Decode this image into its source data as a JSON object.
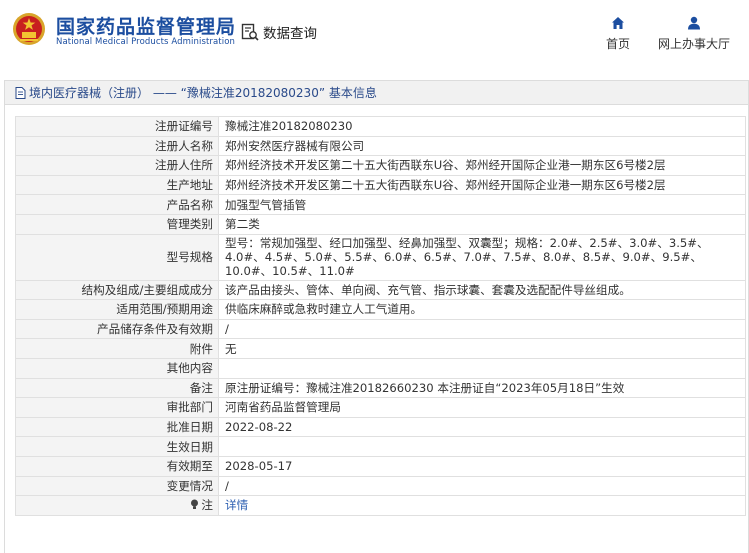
{
  "header": {
    "logo_cn": "国家药品监督管理局",
    "logo_en": "National Medical Products Administration",
    "query_label": "数据查询",
    "nav_home": "首页",
    "nav_office": "网上办事大厅",
    "brand_color": "#1c4ea0"
  },
  "panel": {
    "title": "境内医疗器械（注册） ——  “豫械注准20182080230”  基本信息"
  },
  "rows": [
    {
      "key": "注册证编号",
      "value": "豫械注准20182080230"
    },
    {
      "key": "注册人名称",
      "value": "郑州安然医疗器械有限公司"
    },
    {
      "key": "注册人住所",
      "value": "郑州经济技术开发区第二十五大街西联东U谷、郑州经开国际企业港一期东区6号楼2层"
    },
    {
      "key": "生产地址",
      "value": "郑州经济技术开发区第二十五大街西联东U谷、郑州经开国际企业港一期东区6号楼2层"
    },
    {
      "key": "产品名称",
      "value": "加强型气管插管"
    },
    {
      "key": "管理类别",
      "value": "第二类"
    },
    {
      "key": "型号规格",
      "value": "型号：常规加强型、经口加强型、经鼻加强型、双囊型；规格：2.0#、2.5#、3.0#、3.5#、4.0#、4.5#、5.0#、5.5#、6.0#、6.5#、7.0#、7.5#、8.0#、8.5#、9.0#、9.5#、10.0#、10.5#、11.0#"
    },
    {
      "key": "结构及组成/主要组成成分",
      "value": "该产品由接头、管体、单向阀、充气管、指示球囊、套囊及选配配件导丝组成。"
    },
    {
      "key": "适用范围/预期用途",
      "value": "供临床麻醉或急救时建立人工气道用。"
    },
    {
      "key": "产品储存条件及有效期",
      "value": "/"
    },
    {
      "key": "附件",
      "value": "无"
    },
    {
      "key": "其他内容",
      "value": ""
    },
    {
      "key": "备注",
      "value": "原注册证编号：豫械注准20182660230 本注册证自“2023年05月18日”生效"
    },
    {
      "key": "审批部门",
      "value": "河南省药品监督管理局"
    },
    {
      "key": "批准日期",
      "value": "2022-08-22"
    },
    {
      "key": "生效日期",
      "value": ""
    },
    {
      "key": "有效期至",
      "value": "2028-05-17"
    },
    {
      "key": "变更情况",
      "value": "/"
    }
  ],
  "note_row": {
    "key": "注",
    "value": "详情",
    "key_icon": "bulb-icon"
  }
}
